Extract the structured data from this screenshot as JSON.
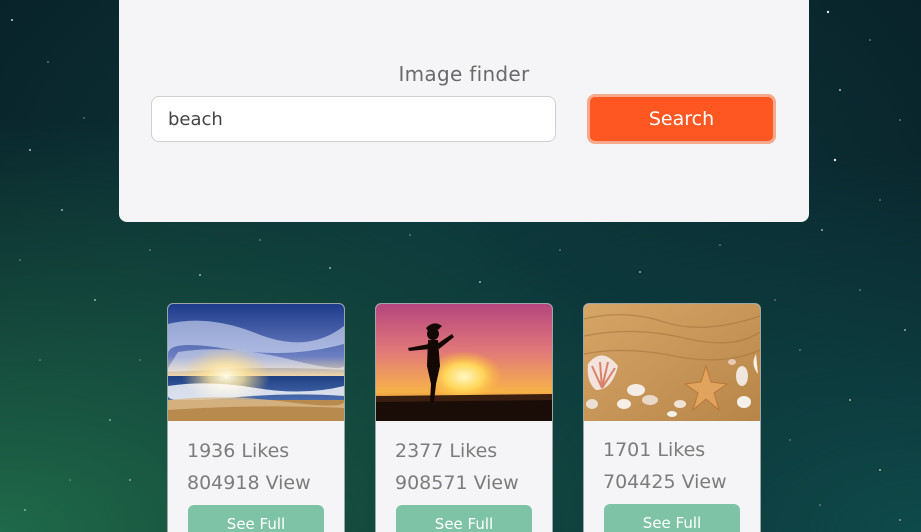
{
  "finder": {
    "title": "Image finder",
    "query": "beach",
    "search_label": "Search"
  },
  "results": [
    {
      "likes": "1936 Likes",
      "views": "804918 View",
      "button": "See Full",
      "image": "beach-sunset-waves"
    },
    {
      "likes": "2377 Likes",
      "views": "908571 View",
      "button": "See Full",
      "image": "silhouette-woman-sunset"
    },
    {
      "likes": "1701 Likes",
      "views": "704425 View",
      "button": "See Full",
      "image": "sand-seashells-starfish"
    }
  ],
  "colors": {
    "accent": "#ff5722",
    "card_button": "#7fc3a6",
    "panel": "#f5f5f7"
  }
}
